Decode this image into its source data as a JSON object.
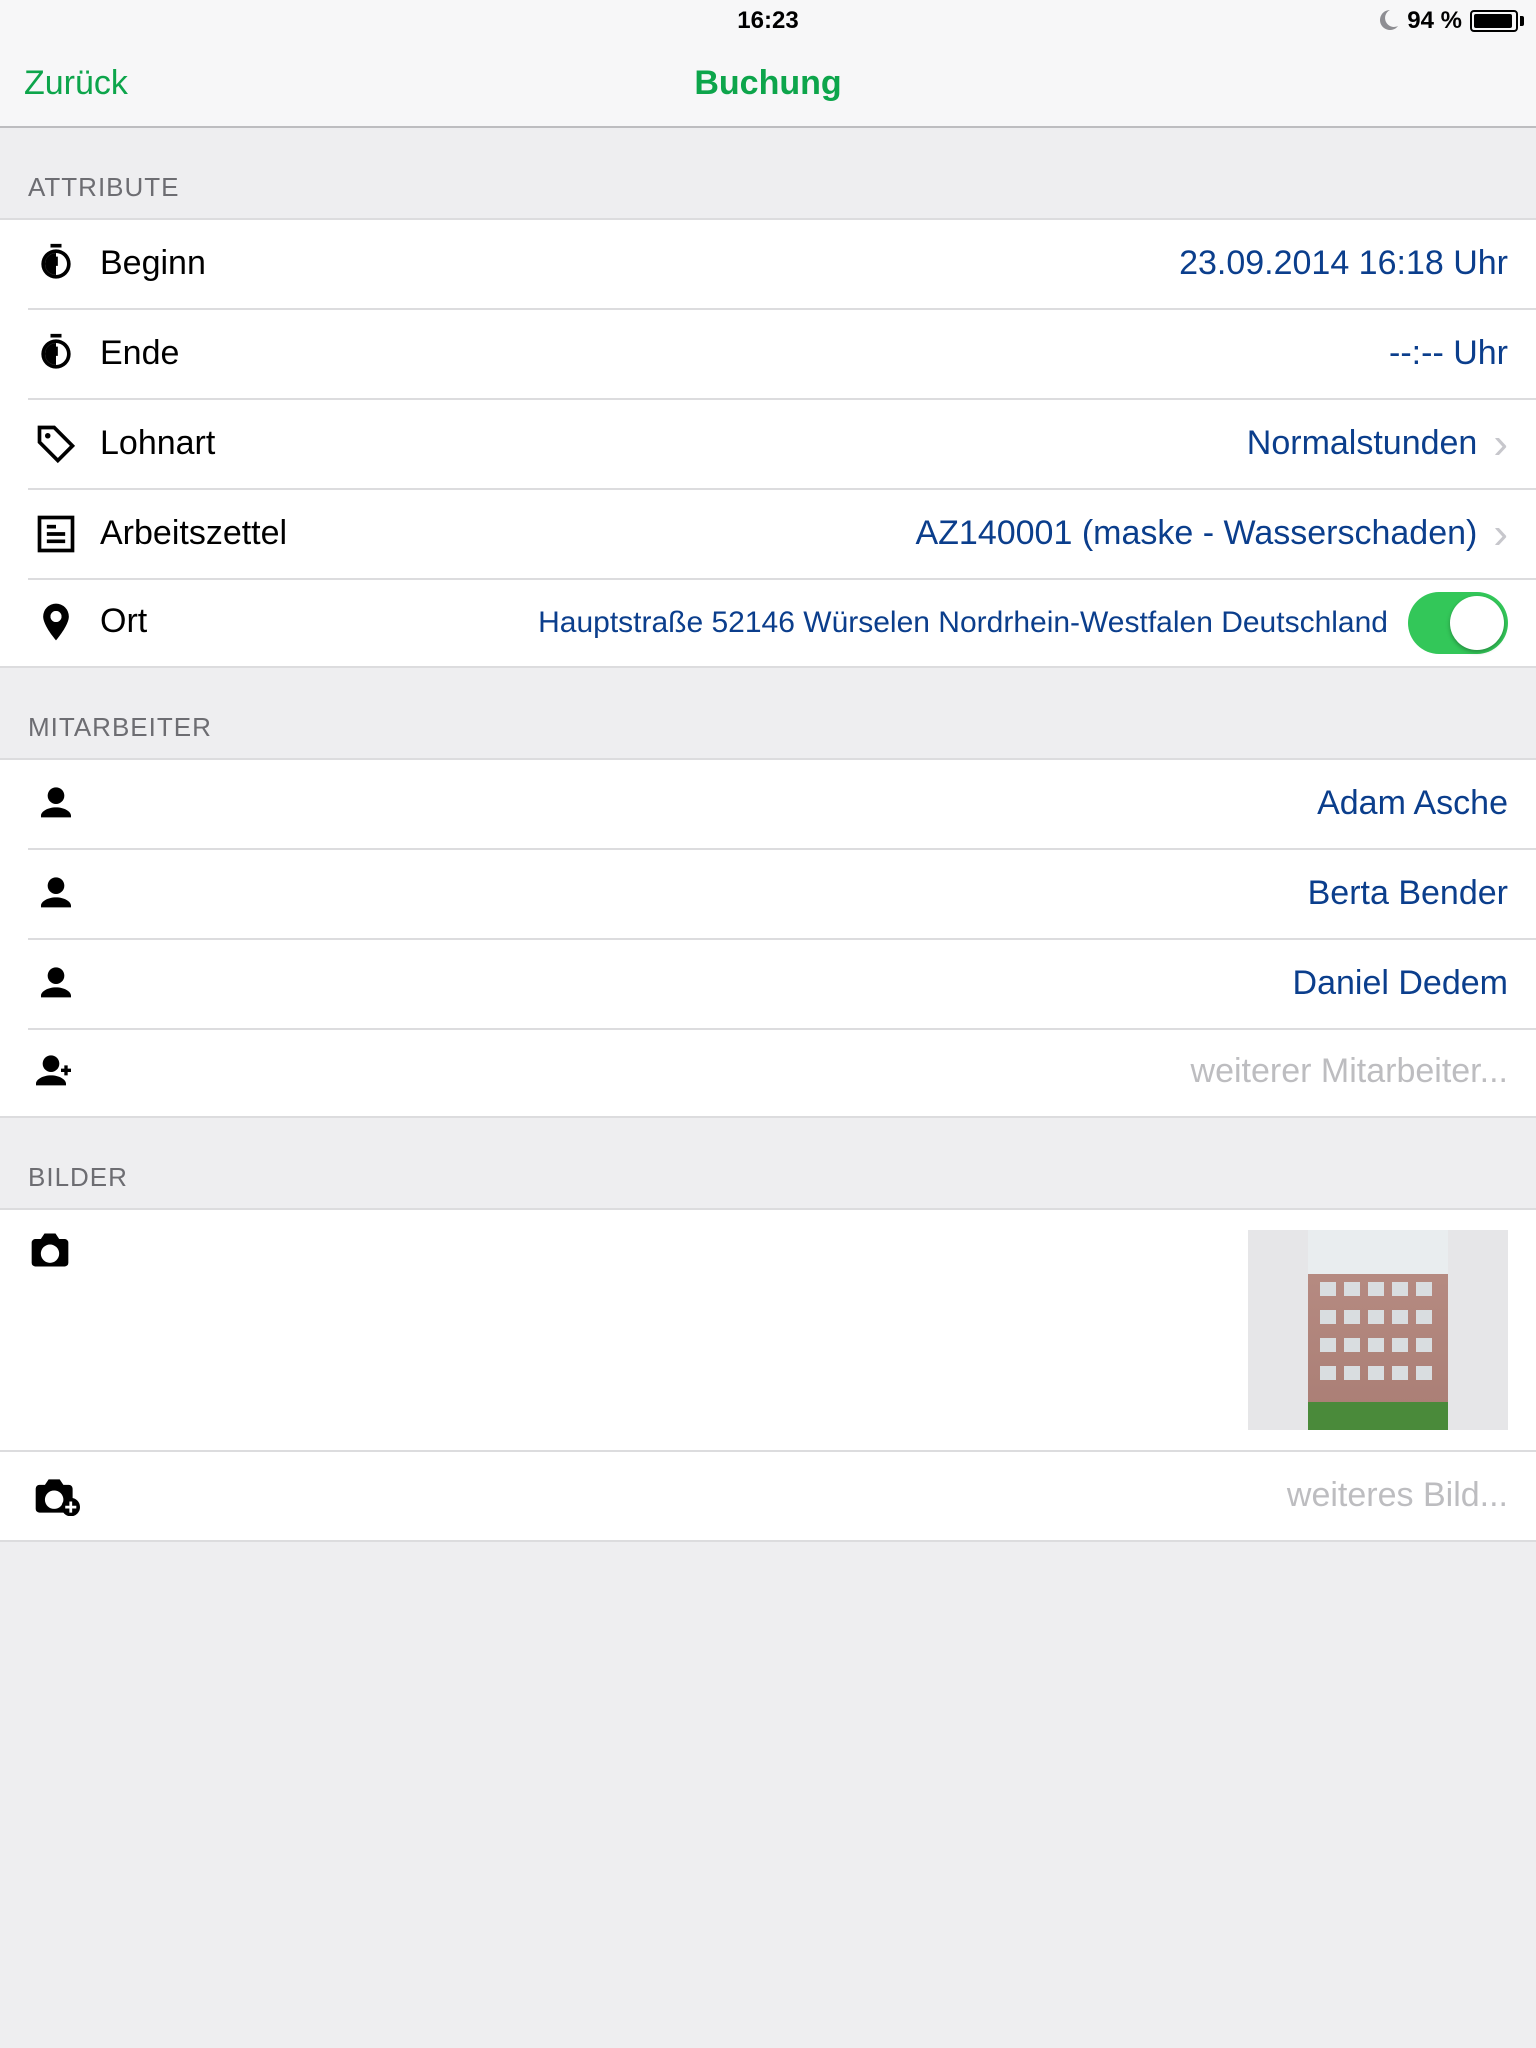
{
  "status": {
    "time": "16:23",
    "battery_text": "94 %"
  },
  "nav": {
    "back": "Zurück",
    "title": "Buchung"
  },
  "sections": {
    "attribute": "Attribute",
    "mitarbeiter": "Mitarbeiter",
    "bilder": "Bilder"
  },
  "attribute": {
    "beginn": {
      "label": "Beginn",
      "value": "23.09.2014 16:18 Uhr"
    },
    "ende": {
      "label": "Ende",
      "value": "--:-- Uhr"
    },
    "lohnart": {
      "label": "Lohnart",
      "value": "Normalstunden"
    },
    "arbeitszettel": {
      "label": "Arbeitszettel",
      "value": "AZ140001 (maske - Wasserschaden)"
    },
    "ort": {
      "label": "Ort",
      "value": "Hauptstraße 52146 Würselen Nordrhein-Westfalen Deutschland"
    }
  },
  "mitarbeiter": {
    "items": [
      "Adam Asche",
      "Berta Bender",
      "Daniel Dedem"
    ],
    "add_placeholder": "weiterer Mitarbeiter..."
  },
  "bilder": {
    "add_placeholder": "weiteres Bild..."
  }
}
